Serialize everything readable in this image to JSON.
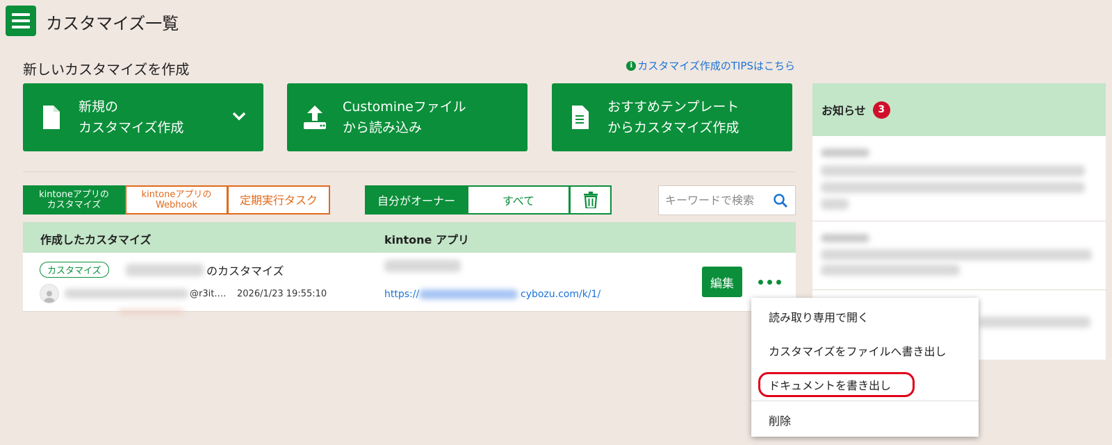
{
  "header": {
    "title": "カスタマイズ一覧"
  },
  "create": {
    "section_title": "新しいカスタマイズを作成",
    "tips_link": "カスタマイズ作成のTIPSはこちら",
    "buttons": [
      {
        "label": "新規の\nカスタマイズ作成",
        "icon": "file-icon"
      },
      {
        "label": "Customineファイル\nから読み込み",
        "icon": "upload-icon"
      },
      {
        "label": "おすすめテンプレート\nからカスタマイズ作成",
        "icon": "document-icon"
      }
    ]
  },
  "type_tabs": [
    "kintoneアプリの\nカスタマイズ",
    "kintoneアプリの\nWebhook",
    "定期実行タスク"
  ],
  "owner_tabs": [
    "自分がオーナー",
    "すべて"
  ],
  "search": {
    "placeholder": "キーワードで検索"
  },
  "table": {
    "headers": [
      "作成したカスタマイズ",
      "kintone アプリ"
    ],
    "rows": [
      {
        "tag": "カスタマイズ",
        "name_suffix": "のカスタマイズ",
        "owner_suffix": "@r3it.…",
        "date": "2026/1/23 19:55:10",
        "url_prefix": "https://",
        "url_suffix": "cybozu.com/k/1/",
        "edit_label": "編集"
      }
    ]
  },
  "notices": {
    "title": "お知らせ",
    "count": "3"
  },
  "dropdown": {
    "items": [
      "読み取り専用で開く",
      "カスタマイズをファイルへ書き出し",
      "ドキュメントを書き出し",
      "削除"
    ],
    "highlighted": "ドキュメントを書き出し"
  },
  "colors": {
    "primary": "#0b8f3a",
    "accent_orange": "#e06a1b",
    "header_green": "#c3e5c8",
    "badge_red": "#d0102a",
    "link": "#1a73d6"
  }
}
